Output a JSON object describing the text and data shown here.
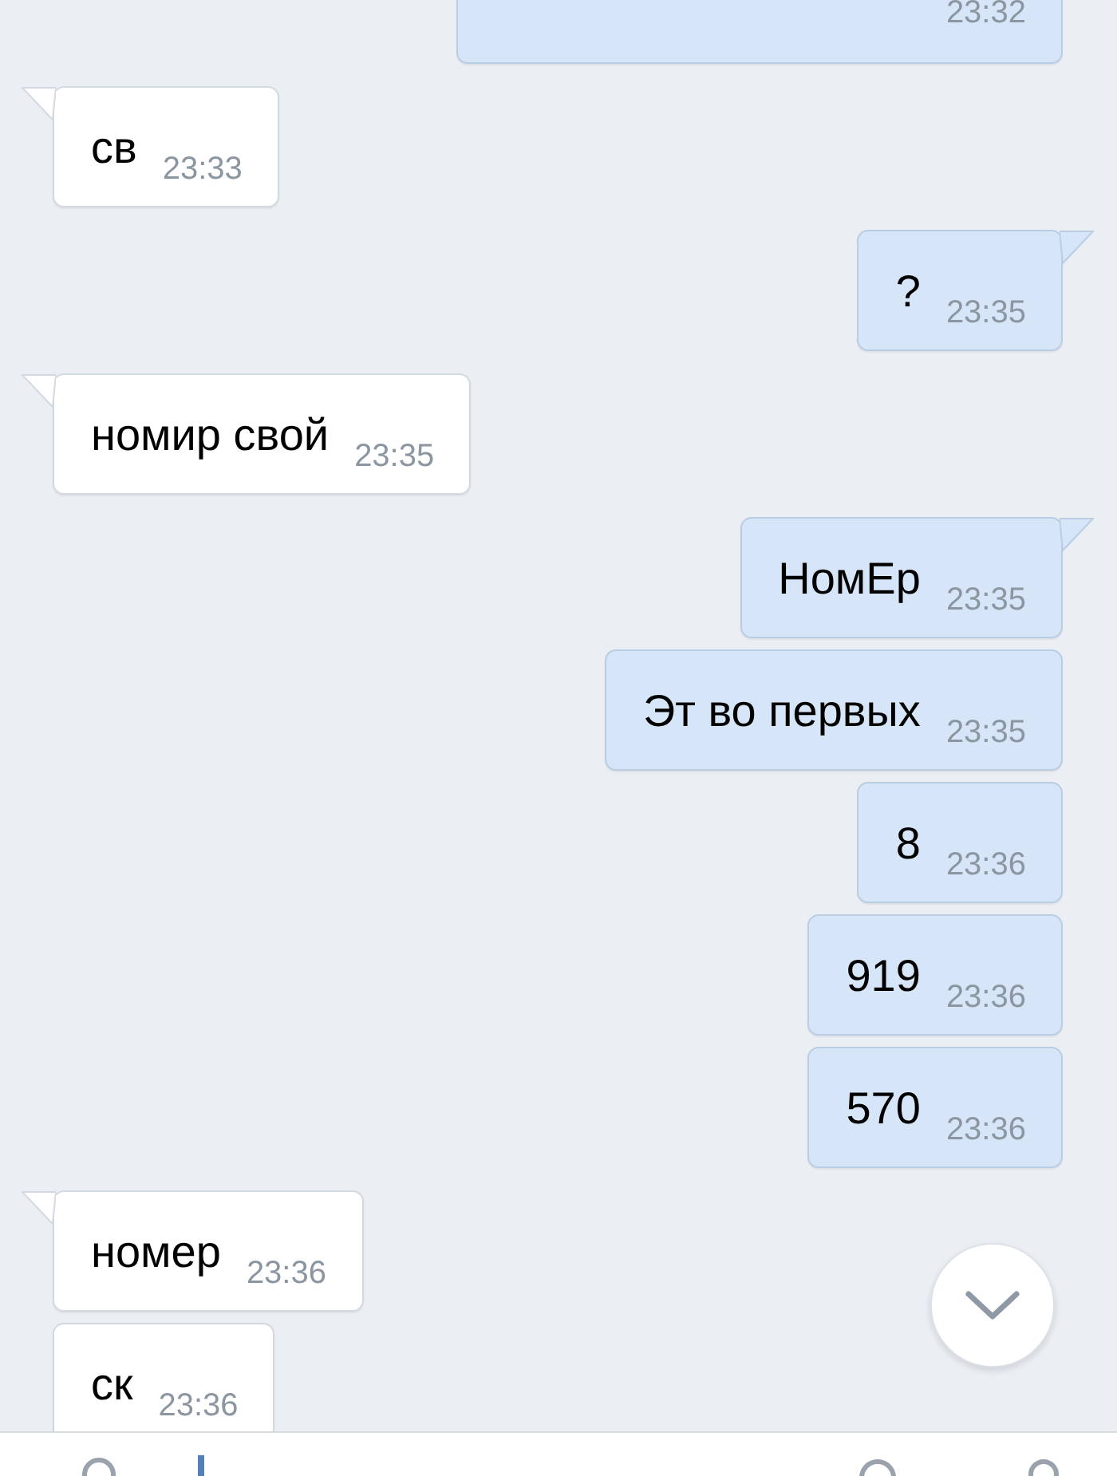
{
  "messages": [
    {
      "kind": "sent",
      "time": "23:32",
      "tail": false
    },
    {
      "kind": "received",
      "text": "св",
      "time": "23:33",
      "tail": true
    },
    {
      "kind": "sent",
      "text": "?",
      "time": "23:35",
      "tail": true
    },
    {
      "kind": "received",
      "text": "номир свой",
      "time": "23:35",
      "tail": true
    },
    {
      "kind": "sent",
      "text": "НомЕр",
      "time": "23:35",
      "tail": true
    },
    {
      "kind": "sent",
      "text": "Эт во первых",
      "time": "23:35",
      "tail": false
    },
    {
      "kind": "sent",
      "text": "8",
      "time": "23:36",
      "tail": false
    },
    {
      "kind": "sent",
      "text": "919",
      "time": "23:36",
      "tail": false
    },
    {
      "kind": "sent",
      "text": "570",
      "time": "23:36",
      "tail": false
    },
    {
      "kind": "received",
      "text": "номер",
      "time": "23:36",
      "tail": true
    },
    {
      "kind": "received",
      "text": "ск",
      "time": "23:36",
      "tail": false
    }
  ]
}
